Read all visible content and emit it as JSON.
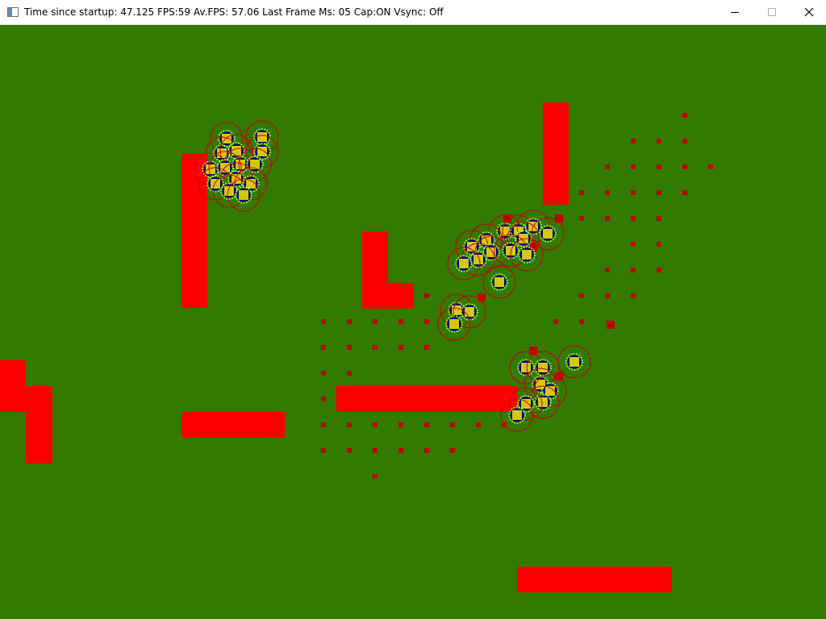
{
  "window": {
    "title": "Time since startup: 47.125 FPS:59 Av.FPS: 57.06 Last Frame Ms: 05 Cap:ON Vsync: Off"
  },
  "icons": {
    "app": "app-window-icon",
    "minimize": "minimize-icon",
    "maximize": "maximize-icon",
    "close": "close-icon"
  },
  "colors": {
    "ground": "#337a00",
    "wall": "#ff0000",
    "marker": "#c00000",
    "marker_faded": "#b02000",
    "unit_fill": "#d4c800",
    "unit_inner_ring": "#000080",
    "unit_range_ring": "#cc0000",
    "unit_glow": "#a0ff40"
  }
}
